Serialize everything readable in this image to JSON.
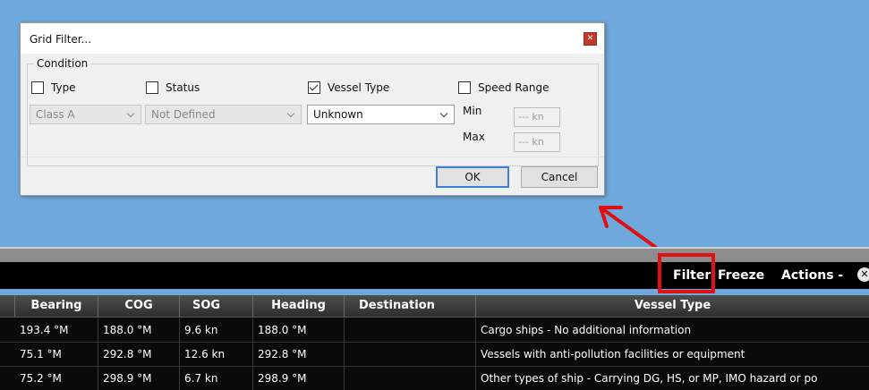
{
  "dialog": {
    "title": "Grid Filter...",
    "close_glyph": "✕",
    "group_label": "Condition",
    "type_label": "Type",
    "status_label": "Status",
    "vessel_type_label": "Vessel Type",
    "speed_range_label": "Speed Range",
    "type_value": "Class A",
    "status_value": "Not Defined",
    "vessel_type_value": "Unknown",
    "min_label": "Min",
    "max_label": "Max",
    "min_value": "--- kn",
    "max_value": "--- kn",
    "ok_label": "OK",
    "cancel_label": "Cancel"
  },
  "toolbar": {
    "filter_label": "Filter",
    "freeze_label": "Freeze",
    "actions_label": "Actions -"
  },
  "grid": {
    "columns": [
      "Bearing",
      "COG",
      "SOG",
      "Heading",
      "Destination",
      "Vessel Type"
    ],
    "rows": [
      [
        "193.4 °M",
        "188.0 °M",
        "9.6 kn",
        "188.0 °M",
        "",
        "Cargo ships - No additional information"
      ],
      [
        "75.1 °M",
        "292.8 °M",
        "12.6 kn",
        "292.8 °M",
        "",
        "Vessels with anti-pollution facilities or equipment"
      ],
      [
        "75.2 °M",
        "298.9 °M",
        "6.7 kn",
        "298.9 °M",
        "",
        "Other types of ship - Carrying DG, HS, or MP, IMO hazard or po"
      ]
    ]
  },
  "colors": {
    "background": "#6fa8dc",
    "highlight": "#e01010",
    "toolbar": "#000000"
  }
}
